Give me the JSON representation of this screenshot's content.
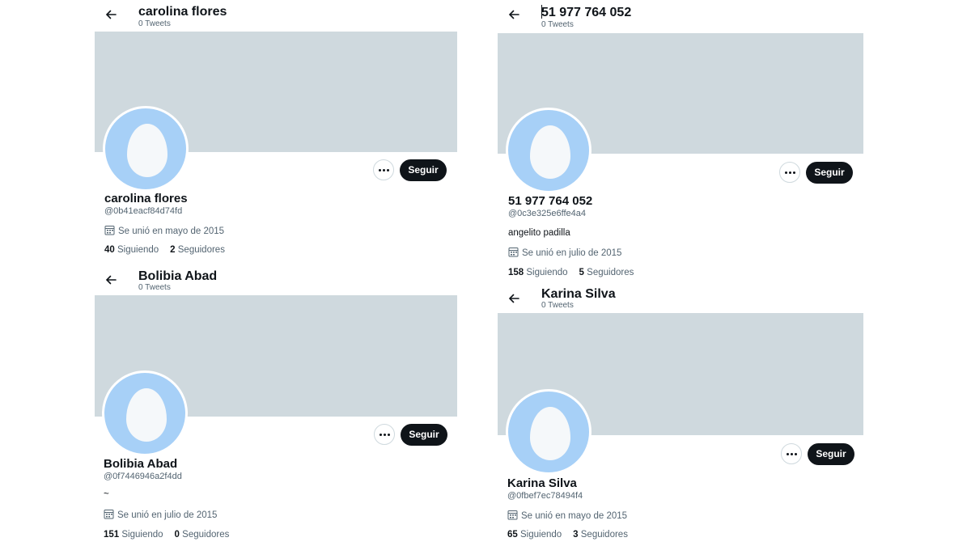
{
  "profiles": [
    {
      "header_name": "carolina flores",
      "header_tweets": "0 Tweets",
      "name": "carolina flores",
      "handle": "@0b41eacf84d74fd",
      "joined": "Se unió en mayo de 2015",
      "following_count": "40",
      "following_label": "Siguiendo",
      "followers_count": "2",
      "followers_label": "Seguidores",
      "follow_label": "Seguir"
    },
    {
      "header_name": "51 977 764 052",
      "header_tweets": "0 Tweets",
      "name": "51 977 764 052",
      "handle": "@0c3e325e6ffe4a4",
      "bio": "angelito padilla",
      "joined": "Se unió en julio de 2015",
      "following_count": "158",
      "following_label": "Siguiendo",
      "followers_count": "5",
      "followers_label": "Seguidores",
      "follow_label": "Seguir"
    },
    {
      "header_name": "Bolibia Abad",
      "header_tweets": "0 Tweets",
      "name": "Bolibia Abad",
      "handle": "@0f7446946a2f4dd",
      "bio": "~",
      "joined": "Se unió en julio de 2015",
      "following_count": "151",
      "following_label": "Siguiendo",
      "followers_count": "0",
      "followers_label": "Seguidores",
      "follow_label": "Seguir"
    },
    {
      "header_name": "Karina Silva",
      "header_tweets": "0 Tweets",
      "name": "Karina Silva",
      "handle": "@0fbef7ec78494f4",
      "joined": "Se unió en mayo de 2015",
      "following_count": "65",
      "following_label": "Siguiendo",
      "followers_count": "3",
      "followers_label": "Seguidores",
      "follow_label": "Seguir"
    }
  ],
  "icons": {
    "back": "arrow-left-icon",
    "more": "more-horizontal-icon",
    "calendar": "calendar-icon",
    "avatar": "default-egg-avatar"
  },
  "colors": {
    "banner": "#cfd9de",
    "avatar_bg": "#a7d0f7",
    "follow_button": "#0f1419",
    "secondary_text": "#536471"
  }
}
